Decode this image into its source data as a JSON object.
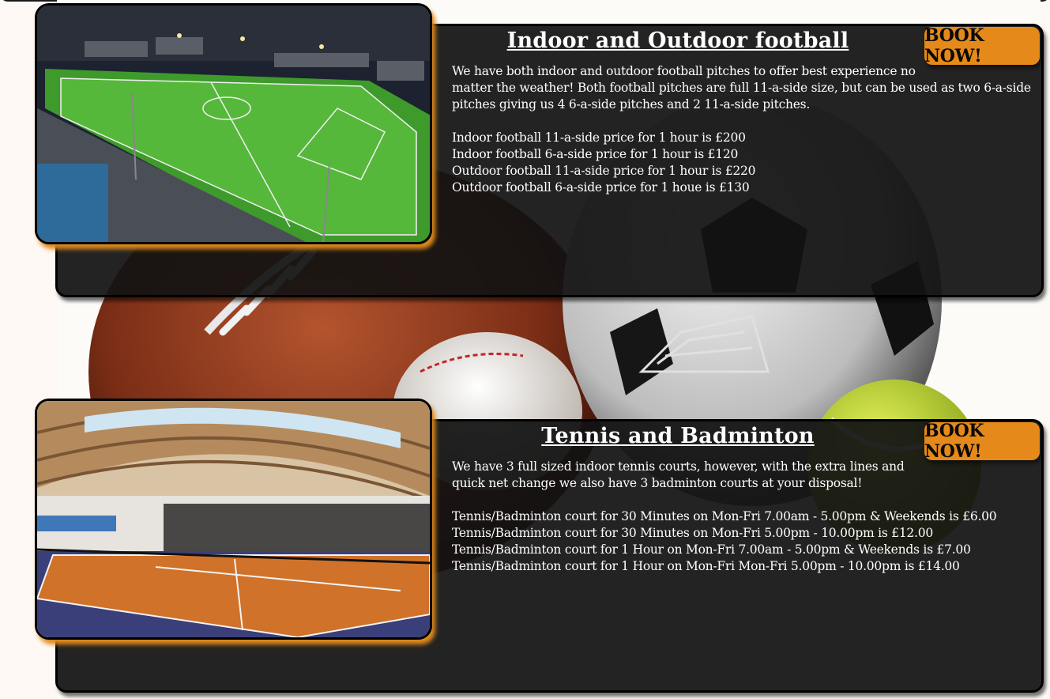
{
  "colors": {
    "accent": "#e5891a",
    "card_bg": "#121212",
    "text": "#ffffff"
  },
  "sections": [
    {
      "image_alt": "football-pitch-photo",
      "title": "Indoor and Outdoor football",
      "book_label": "BOOK NOW!",
      "description_lines": [
        "We have both indoor and outdoor football pitches to offer best experience no",
        "matter the weather! Both football pitches are full 11-a-side size, but can be used as two 6-a-side",
        "pitches giving us 4 6-a-side pitches and 2 11-a-side pitches."
      ],
      "prices": [
        "Indoor football 11-a-side price for 1 hour is £200",
        "Indoor football 6-a-side price for 1 hour is £120",
        "Outdoor football 11-a-side price for 1 hour is £220",
        "Outdoor football 6-a-side price for 1 houe is £130"
      ]
    },
    {
      "image_alt": "tennis-court-photo",
      "title": "Tennis and Badminton",
      "book_label": "BOOK NOW!",
      "description_lines": [
        "We have 3 full sized indoor tennis courts, however, with the extra lines and",
        "quick net change we also have 3 badminton courts at your disposal!"
      ],
      "prices": [
        "Tennis/Badminton court for 30 Minutes on Mon-Fri 7.00am - 5.00pm & Weekends is £6.00",
        "Tennis/Badminton court for 30 Minutes on Mon-Fri 5.00pm - 10.00pm is £12.00",
        "Tennis/Badminton court for 1 Hour on Mon-Fri 7.00am - 5.00pm & Weekends is £7.00",
        "Tennis/Badminton court for 1 Hour on Mon-Fri Mon-Fri 5.00pm - 10.00pm is £14.00"
      ]
    }
  ]
}
